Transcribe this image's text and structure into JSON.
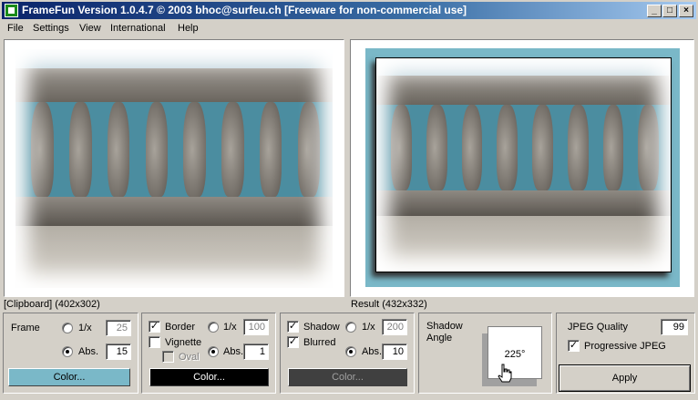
{
  "window": {
    "title": "FrameFun Version 1.0.4.7 © 2003 bhoc@surfeu.ch [Freeware for non-commercial use]",
    "minimize_glyph": "_",
    "maximize_glyph": "□",
    "close_glyph": "×"
  },
  "menu": {
    "items": [
      {
        "label": "File"
      },
      {
        "label": "Settings"
      },
      {
        "label": "View"
      },
      {
        "label": "International"
      },
      {
        "label": "Help"
      }
    ]
  },
  "source": {
    "caption": "[Clipboard] (402x302)"
  },
  "result": {
    "caption": "Result (432x332)",
    "frame_color": "#7ab8c8"
  },
  "frame": {
    "label": "Frame",
    "recip_label": "1/x",
    "recip_value": "25",
    "abs_label": "Abs.",
    "abs_value": "15",
    "abs_selected": true,
    "color_label": "Color...",
    "color": "#7ab8c8"
  },
  "border": {
    "label": "Border",
    "checked": true,
    "vignette_label": "Vignette",
    "vignette_checked": false,
    "oval_label": "Oval",
    "recip_label": "1/x",
    "recip_value": "100",
    "abs_label": "Abs.",
    "abs_value": "1",
    "color_label": "Color...",
    "color": "#000000"
  },
  "shadow": {
    "label": "Shadow",
    "checked": true,
    "blurred_label": "Blurred",
    "blurred_checked": true,
    "recip_label": "1/x",
    "recip_value": "200",
    "abs_label": "Abs.",
    "abs_value": "10",
    "color_label": "Color...",
    "color": "#404040",
    "angle_label": "Shadow Angle",
    "angle_value": "225°"
  },
  "jpeg": {
    "quality_label": "JPEG Quality",
    "quality_value": "99",
    "progressive_label": "Progressive JPEG",
    "progressive_checked": true
  },
  "apply": {
    "label": "Apply"
  }
}
